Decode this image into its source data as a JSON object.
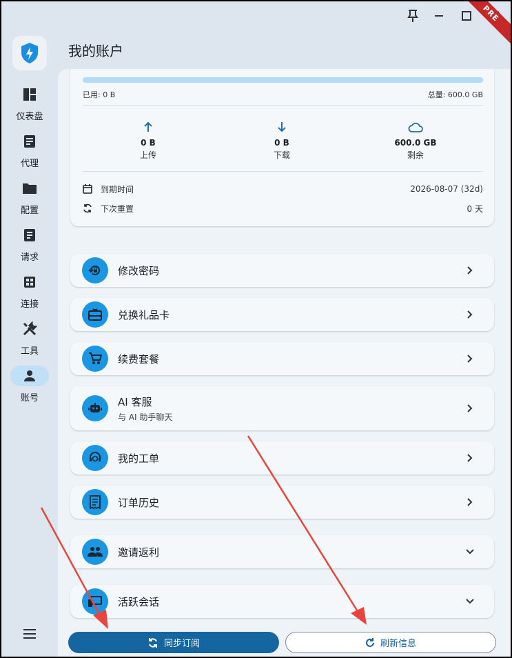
{
  "window": {
    "badge": "PRE",
    "pin_icon": "pin-icon",
    "minimize_icon": "minimize-icon",
    "maximize_icon": "maximize-icon",
    "close_icon": "close-icon"
  },
  "header": {
    "title": "我的账户"
  },
  "sidebar": {
    "logo_icon": "shield-bolt-logo",
    "items": [
      {
        "label": "仪表盘",
        "icon": "dashboard-icon",
        "active": false
      },
      {
        "label": "代理",
        "icon": "proxy-icon",
        "active": false
      },
      {
        "label": "配置",
        "icon": "folder-icon",
        "active": false
      },
      {
        "label": "请求",
        "icon": "requests-icon",
        "active": false
      },
      {
        "label": "连接",
        "icon": "connections-icon",
        "active": false
      },
      {
        "label": "工具",
        "icon": "tools-icon",
        "active": false
      },
      {
        "label": "账号",
        "icon": "person-icon",
        "active": true
      }
    ],
    "menu_icon": "hamburger-icon"
  },
  "usage": {
    "used_label": "已用: 0 B",
    "total_label": "总量: 600.0 GB",
    "used_fraction": 0,
    "upload_value": "0 B",
    "upload_label": "上传",
    "download_value": "0 B",
    "download_label": "下载",
    "remaining_value": "600.0 GB",
    "remaining_label": "剩余",
    "expiry_label": "到期时间",
    "expiry_value": "2026-08-07 (32d)",
    "reset_label": "下次重置",
    "reset_value": "0 天"
  },
  "menu": [
    {
      "title": "修改密码",
      "icon": "lock-reset-icon",
      "chevron": "chevron-right-icon"
    },
    {
      "title": "兑换礼品卡",
      "icon": "gift-card-icon",
      "chevron": "chevron-right-icon"
    },
    {
      "title": "续费套餐",
      "icon": "cart-icon",
      "chevron": "chevron-right-icon"
    },
    {
      "title": "AI 客服",
      "subtitle": "与 AI 助手聊天",
      "icon": "robot-icon",
      "chevron": "chevron-right-icon"
    },
    {
      "title": "我的工单",
      "icon": "support-agent-icon",
      "chevron": "chevron-right-icon"
    },
    {
      "title": "订单历史",
      "icon": "receipt-icon",
      "chevron": "chevron-right-icon"
    },
    {
      "title": "邀请返利",
      "icon": "people-icon",
      "chevron": "chevron-down-icon"
    },
    {
      "title": "活跃会话",
      "icon": "devices-icon",
      "chevron": "chevron-down-icon"
    }
  ],
  "buttons": {
    "sync_label": "同步订阅",
    "refresh_label": "刷新信息"
  },
  "colors": {
    "accent": "#1a96e2",
    "primary_button": "#1565a1",
    "active_nav": "#bfe0f7",
    "arrow": "#e8453c"
  }
}
